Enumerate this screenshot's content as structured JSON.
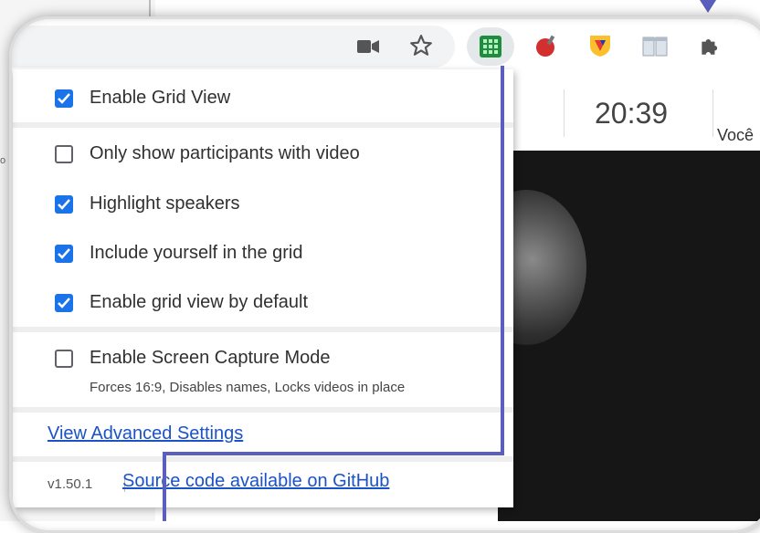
{
  "meet": {
    "time": "20:39",
    "user_label": "Você"
  },
  "background": {
    "left_text": "o"
  },
  "toolbar": {
    "icons": [
      "camera-icon",
      "star-icon",
      "grid-extension-icon",
      "apple-extension-icon",
      "shield-extension-icon",
      "columns-extension-icon",
      "puzzle-icon"
    ]
  },
  "popup": {
    "options": [
      {
        "label": "Enable Grid View",
        "checked": true
      },
      {
        "label": "Only show participants with video",
        "checked": false
      },
      {
        "label": "Highlight speakers",
        "checked": true
      },
      {
        "label": "Include yourself in the grid",
        "checked": true
      },
      {
        "label": "Enable grid view by default",
        "checked": true
      },
      {
        "label": "Enable Screen Capture Mode",
        "checked": false
      }
    ],
    "screen_capture_hint": "Forces 16:9, Disables names, Locks videos in place",
    "advanced_link": "View Advanced Settings",
    "version": "v1.50.1",
    "source_link": "Source code available on GitHub"
  },
  "colors": {
    "accent": "#1a73e8",
    "annotation": "#5a5fbd",
    "grid_icon": "#1e8e3e"
  }
}
